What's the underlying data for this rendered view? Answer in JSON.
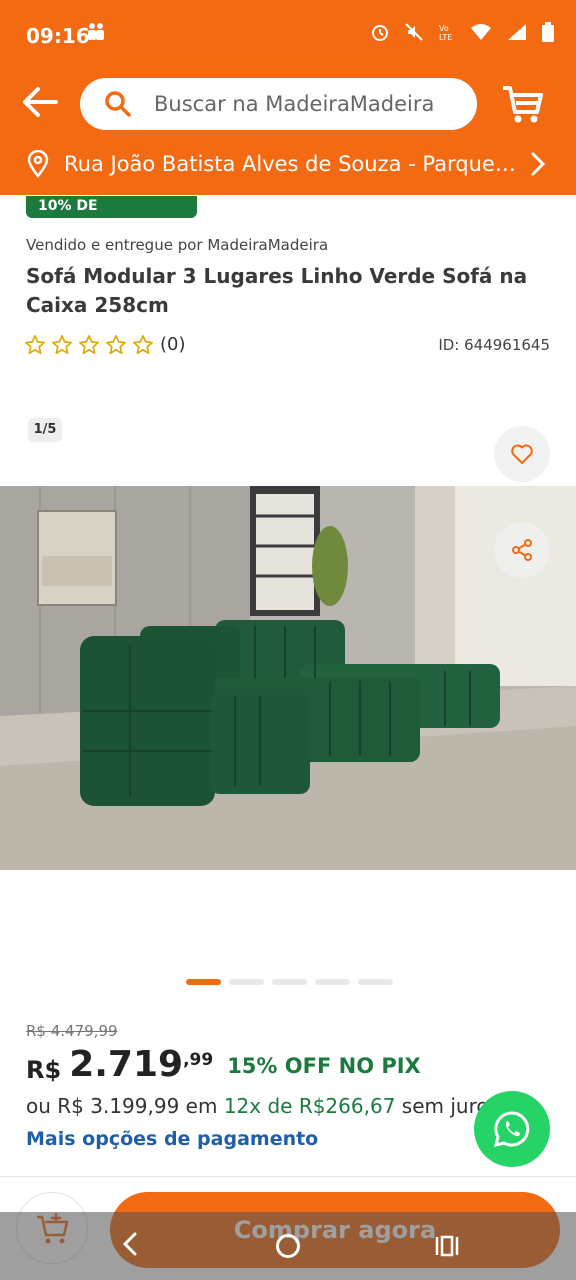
{
  "status_bar": {
    "time": "09:16"
  },
  "header": {
    "search_placeholder": "Buscar na MadeiraMadeira",
    "address": "Rua João Batista Alves de Souza - Parque I..."
  },
  "product": {
    "discount_badge": "10% DE",
    "sold_by": "Vendido e entregue por MadeiraMadeira",
    "title": "Sofá Modular 3 Lugares Linho Verde Sofá na Caixa 258cm",
    "rating": 0,
    "review_count": "(0)",
    "id_label": "ID: 644961645",
    "gallery_counter": "1/5",
    "gallery_total": 5,
    "gallery_active": 1
  },
  "pricing": {
    "old_price": "R$ 4.479,99",
    "currency": "R$",
    "price_int": "2.719",
    "price_cents": ",99",
    "pix_discount": "15% OFF NO PIX",
    "installments_prefix": "ou R$ 3.199,99 em ",
    "installments_highlight": "12x de R$266,67",
    "installments_suffix": " sem juros",
    "more_payment": "Mais opções de pagamento"
  },
  "actions": {
    "buy_now": "Comprar agora"
  },
  "colors": {
    "brand_orange": "#f36a12",
    "green": "#1d7a3e",
    "link_blue": "#1f5ea8",
    "whatsapp": "#25d366"
  }
}
